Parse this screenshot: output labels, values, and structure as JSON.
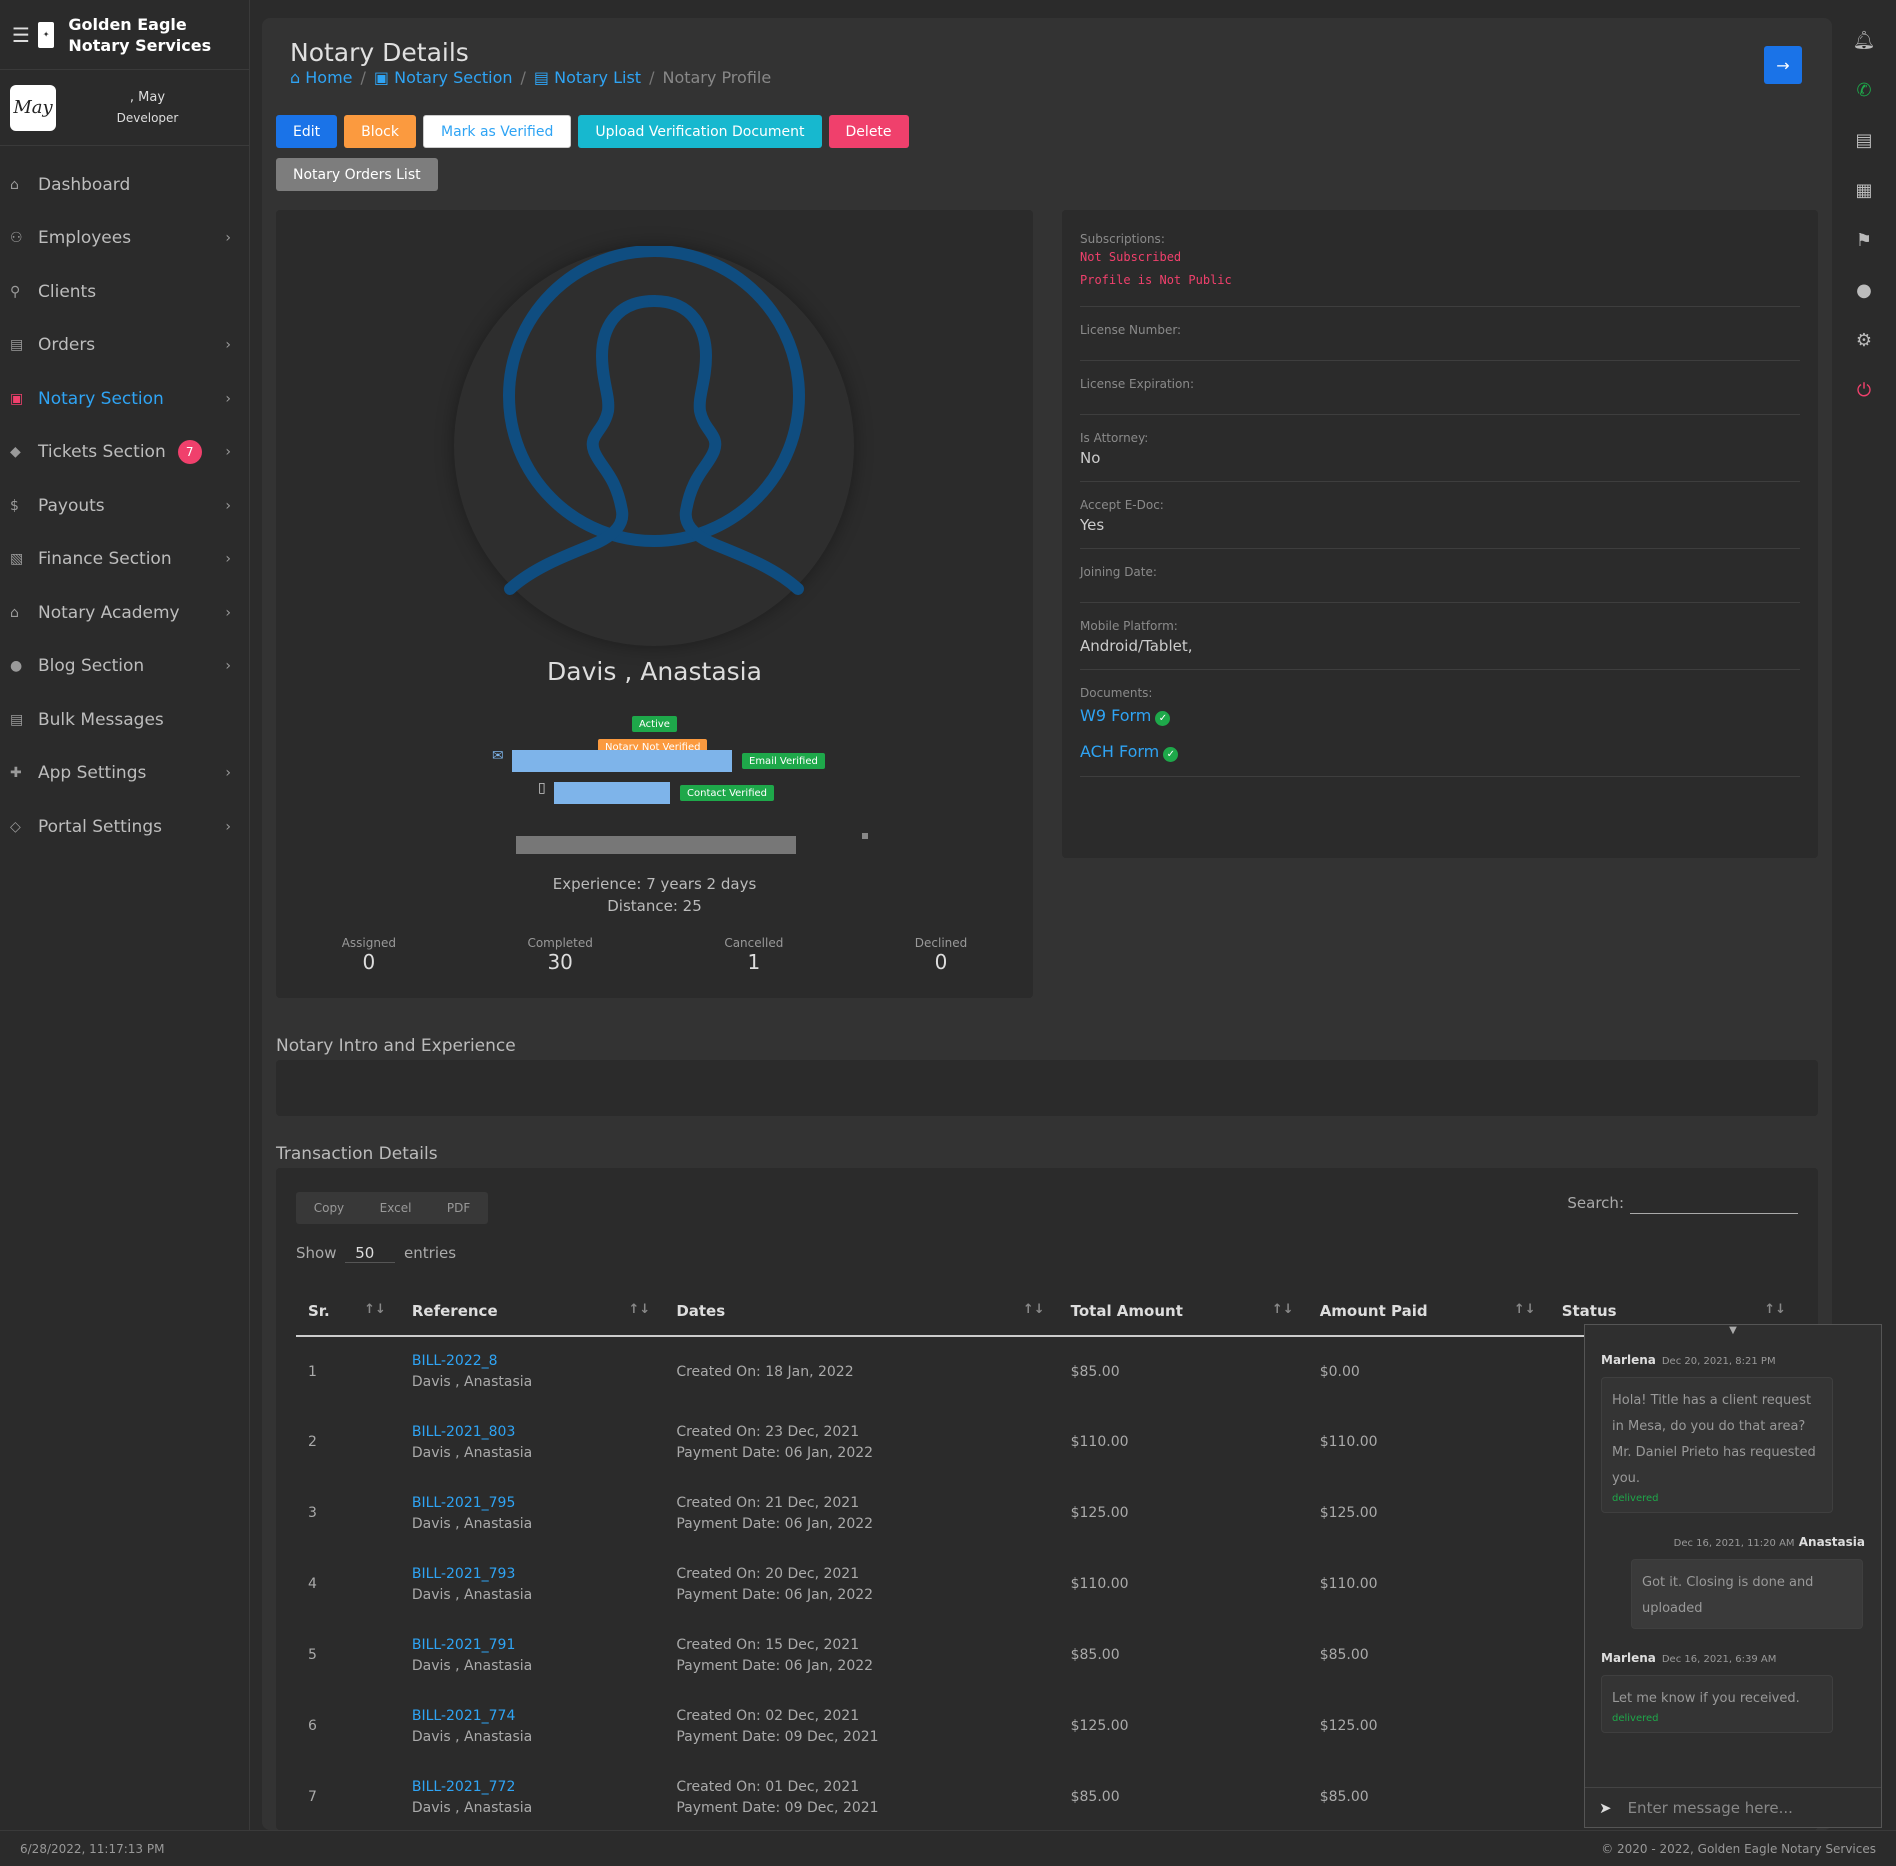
{
  "brand": {
    "title": "Golden Eagle Notary Services"
  },
  "user": {
    "name": ", May",
    "role": "Developer",
    "avatar_text": "May"
  },
  "nav": [
    {
      "label": "Dashboard",
      "icon": "dashboard-icon",
      "has_chevron": false
    },
    {
      "label": "Employees",
      "icon": "users-icon",
      "has_chevron": true
    },
    {
      "label": "Clients",
      "icon": "person-icon",
      "has_chevron": false
    },
    {
      "label": "Orders",
      "icon": "orders-icon",
      "has_chevron": true
    },
    {
      "label": "Notary Section",
      "icon": "notary-icon",
      "has_chevron": true,
      "active": true
    },
    {
      "label": "Tickets Section",
      "icon": "ticket-icon",
      "has_chevron": true,
      "badge": "7"
    },
    {
      "label": "Payouts",
      "icon": "dollar-icon",
      "has_chevron": true
    },
    {
      "label": "Finance Section",
      "icon": "finance-icon",
      "has_chevron": true
    },
    {
      "label": "Notary Academy",
      "icon": "academy-icon",
      "has_chevron": true
    },
    {
      "label": "Blog Section",
      "icon": "blog-icon",
      "has_chevron": true
    },
    {
      "label": "Bulk Messages",
      "icon": "messages-icon",
      "has_chevron": false
    },
    {
      "label": "App Settings",
      "icon": "app-settings-icon",
      "has_chevron": true
    },
    {
      "label": "Portal Settings",
      "icon": "portal-settings-icon",
      "has_chevron": true
    }
  ],
  "page": {
    "title": "Notary Details"
  },
  "breadcrumb": {
    "home": "Home",
    "section": "Notary Section",
    "list": "Notary List",
    "current": "Notary Profile"
  },
  "actions": {
    "edit": "Edit",
    "block": "Block",
    "verify": "Mark as Verified",
    "upload": "Upload Verification Document",
    "delete": "Delete",
    "orders": "Notary Orders List"
  },
  "profile": {
    "name": "Davis , Anastasia",
    "status": "Active",
    "verification": "Notary Not Verified",
    "email_badge": "Email Verified",
    "contact_badge": "Contact Verified",
    "experience": "Experience: 7 years 2 days",
    "distance": "Distance: 25",
    "stats": [
      {
        "label": "Assigned",
        "value": "0"
      },
      {
        "label": "Completed",
        "value": "30"
      },
      {
        "label": "Cancelled",
        "value": "1"
      },
      {
        "label": "Declined",
        "value": "0"
      }
    ]
  },
  "details": {
    "subscriptions_label": "Subscriptions:",
    "subscription_status": "Not Subscribed",
    "public_status": "Profile is Not Public",
    "license_number_label": "License Number:",
    "license_expiration_label": "License Expiration:",
    "attorney_label": "Is Attorney:",
    "attorney_value": "No",
    "edoc_label": "Accept E-Doc:",
    "edoc_value": "Yes",
    "joining_label": "Joining Date:",
    "platform_label": "Mobile Platform:",
    "platform_value": "Android/Tablet,",
    "documents_label": "Documents:",
    "doc_w9": "W9 Form",
    "doc_ach": "ACH Form"
  },
  "intro": {
    "title": "Notary Intro and Experience"
  },
  "transactions": {
    "title": "Transaction Details",
    "buttons": {
      "copy": "Copy",
      "excel": "Excel",
      "pdf": "PDF"
    },
    "search_label": "Search:",
    "show_label": "Show",
    "show_value": "50",
    "entries_label": "entries",
    "columns": [
      "Sr.",
      "Reference",
      "Dates",
      "Total Amount",
      "Amount Paid",
      "Status"
    ],
    "rows": [
      {
        "sr": "1",
        "ref": "BILL-2022_8",
        "name": "Davis , Anastasia",
        "created": "Created On: 18 Jan, 2022",
        "payment": "",
        "total": "$85.00",
        "paid": "$0.00"
      },
      {
        "sr": "2",
        "ref": "BILL-2021_803",
        "name": "Davis , Anastasia",
        "created": "Created On: 23 Dec, 2021",
        "payment": "Payment Date: 06 Jan, 2022",
        "total": "$110.00",
        "paid": "$110.00"
      },
      {
        "sr": "3",
        "ref": "BILL-2021_795",
        "name": "Davis , Anastasia",
        "created": "Created On: 21 Dec, 2021",
        "payment": "Payment Date: 06 Jan, 2022",
        "total": "$125.00",
        "paid": "$125.00"
      },
      {
        "sr": "4",
        "ref": "BILL-2021_793",
        "name": "Davis , Anastasia",
        "created": "Created On: 20 Dec, 2021",
        "payment": "Payment Date: 06 Jan, 2022",
        "total": "$110.00",
        "paid": "$110.00"
      },
      {
        "sr": "5",
        "ref": "BILL-2021_791",
        "name": "Davis , Anastasia",
        "created": "Created On: 15 Dec, 2021",
        "payment": "Payment Date: 06 Jan, 2022",
        "total": "$85.00",
        "paid": "$85.00"
      },
      {
        "sr": "6",
        "ref": "BILL-2021_774",
        "name": "Davis , Anastasia",
        "created": "Created On: 02 Dec, 2021",
        "payment": "Payment Date: 09 Dec, 2021",
        "total": "$125.00",
        "paid": "$125.00"
      },
      {
        "sr": "7",
        "ref": "BILL-2021_772",
        "name": "Davis , Anastasia",
        "created": "Created On: 01 Dec, 2021",
        "payment": "Payment Date: 09 Dec, 2021",
        "total": "$85.00",
        "paid": "$85.00"
      }
    ]
  },
  "chat": {
    "messages": [
      {
        "from": "Marlena",
        "time": "Dec 20, 2021, 8:21 PM",
        "text": "Hola! Title has a client request in Mesa, do you do that area? Mr. Daniel Prieto has requested you.",
        "status": "delivered",
        "side": "left"
      },
      {
        "from": "Anastasia",
        "time": "Dec 16, 2021, 11:20 AM",
        "text": "Got it. Closing is done and uploaded",
        "status": "",
        "side": "right"
      },
      {
        "from": "Marlena",
        "time": "Dec 16, 2021, 6:39 AM",
        "text": "Let me know if you received.",
        "status": "delivered",
        "side": "left"
      }
    ],
    "placeholder": "Enter message here..."
  },
  "footer": {
    "timestamp": "6/28/2022, 11:17:13 PM",
    "copyright": "© 2020 - 2022, Golden Eagle Notary Services"
  },
  "colors": {
    "accent": "#2fa4f4",
    "danger": "#f0406c",
    "success": "#1ea84a",
    "warning": "#fb9a3f",
    "primary": "#1a73e8"
  }
}
